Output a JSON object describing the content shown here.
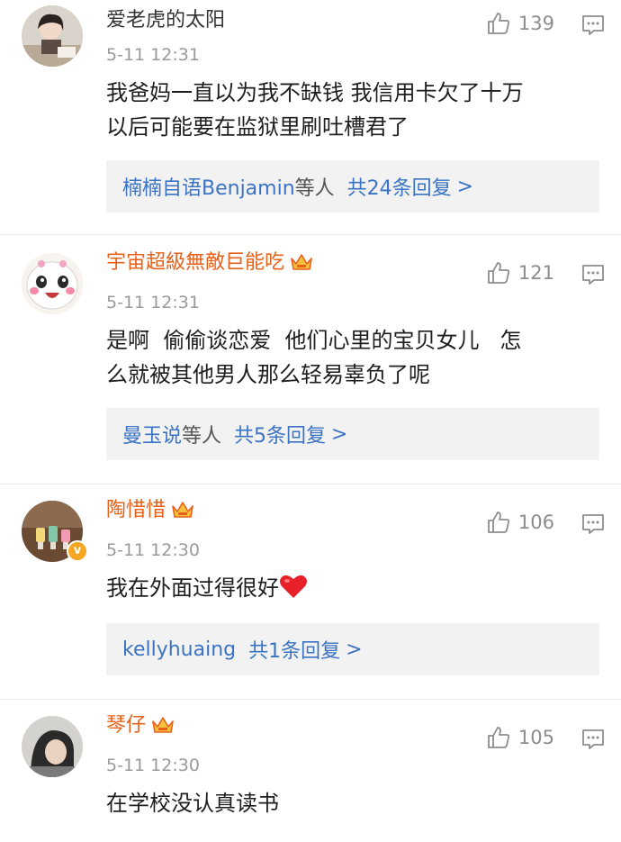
{
  "comments": [
    {
      "user": "爱老虎的太阳",
      "vip": false,
      "time": "5-11 12:31",
      "likes": "139",
      "text_lines": [
        "我爸妈一直以为我不缺钱 我信用卡欠了十万",
        "以后可能要在监狱里刷吐槽君了"
      ],
      "reply_who": "楠楠自语Benjamin",
      "reply_suffix": "等人",
      "reply_total": "共24条回复",
      "reply_arrow": ">"
    },
    {
      "user": "宇宙超級無敵巨能吃",
      "vip": true,
      "time": "5-11 12:31",
      "likes": "121",
      "text_lines": [
        "是啊  偷偷谈恋爱  他们心里的宝贝女儿   怎",
        "么就被其他男人那么轻易辜负了呢"
      ],
      "reply_who": "曼玉说",
      "reply_suffix": "等人",
      "reply_total": "共5条回复",
      "reply_arrow": ">"
    },
    {
      "user": "陶惜惜",
      "vip": true,
      "verified": true,
      "time": "5-11 12:30",
      "likes": "106",
      "text_lines": [
        "我在外面过得很好"
      ],
      "emoji": "heart",
      "reply_who": "kellyhuaing",
      "reply_suffix": "",
      "reply_total": "共1条回复",
      "reply_arrow": ">"
    },
    {
      "user": "琴仔",
      "vip": true,
      "time": "5-11 12:30",
      "likes": "105",
      "text_lines": [
        "在学校没认真读书"
      ]
    }
  ],
  "colors": {
    "vip_name": "#e8611a",
    "link": "#3b74c4",
    "muted": "#9a9a9a",
    "heart": "#e8202a"
  }
}
